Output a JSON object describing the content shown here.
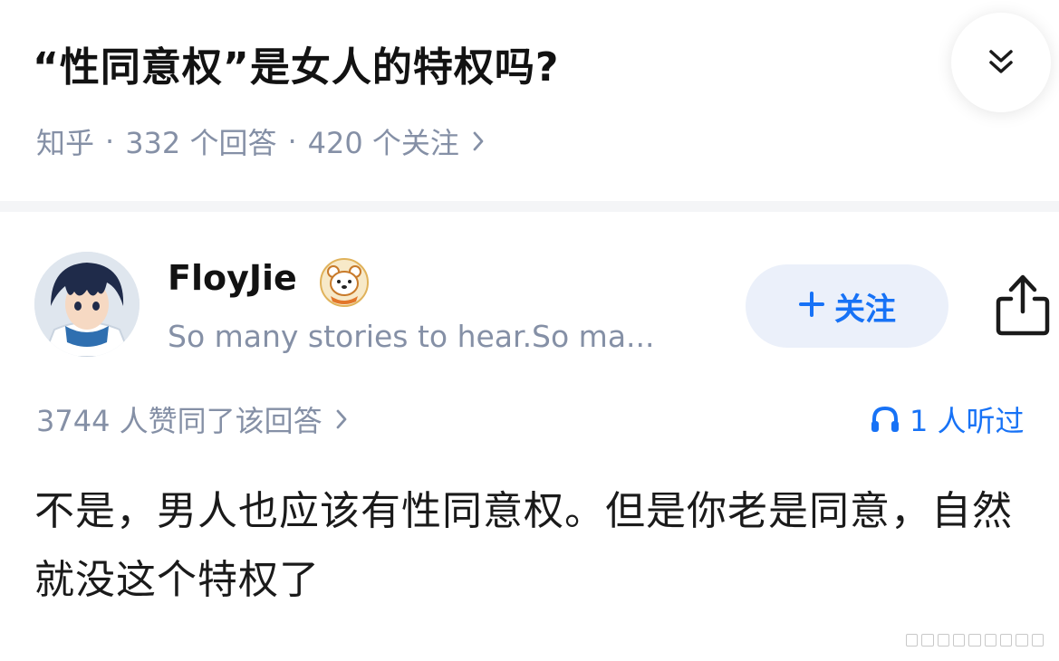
{
  "question": {
    "title": "“性同意权”是女人的特权吗?",
    "source": "知乎",
    "answers_count": "332 个回答",
    "followers_count": "420 个关注"
  },
  "author": {
    "name": "FloyJie",
    "bio": "So many stories to hear.So ma...",
    "avatar_icon": "anime-portrait-avatar",
    "badge_icon": "bear-badge-icon"
  },
  "actions": {
    "follow_label": "关注",
    "follow_icon": "plus-icon",
    "share_icon": "share-icon"
  },
  "stats": {
    "votes_text": "3744 人赞同了该回答",
    "listen_text": "1 人听过"
  },
  "answer": {
    "text": "不是，男人也应该有性同意权。但是你老是同意，自然就没这个特权了"
  },
  "colors": {
    "accent": "#1772f6",
    "meta_gray": "#8590a6",
    "follow_bg": "#ebf0fa"
  }
}
